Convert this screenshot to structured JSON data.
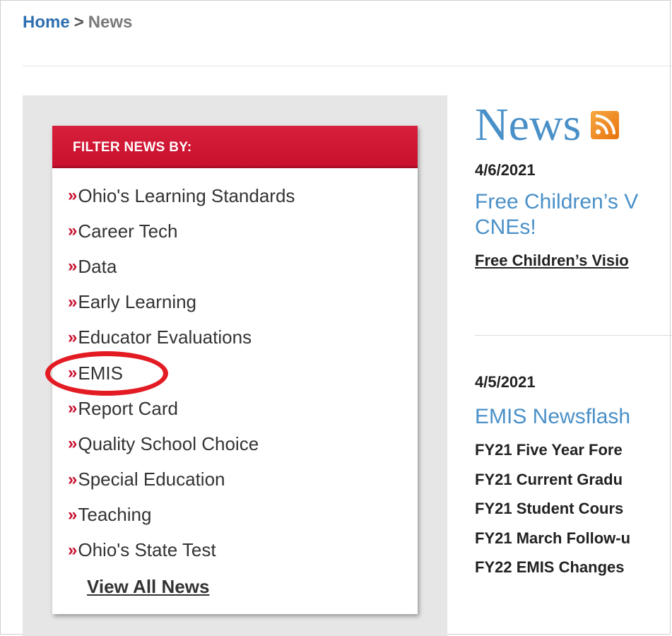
{
  "breadcrumb": {
    "home": "Home",
    "separator": ">",
    "current": "News"
  },
  "filter": {
    "header": "FILTER NEWS BY:",
    "chevron": "»",
    "items": [
      "Ohio's Learning Standards",
      "Career Tech",
      "Data",
      "Early Learning",
      "Educator Evaluations",
      "EMIS",
      "Report Card",
      "Quality School Choice",
      "Special Education",
      "Teaching",
      "Ohio's State Test"
    ],
    "view_all": "View All News",
    "highlighted_item": "EMIS"
  },
  "news": {
    "title": "News",
    "rss_icon": "rss-icon",
    "articles": [
      {
        "date": "4/6/2021",
        "headline_line1": "Free Children’s V",
        "headline_line2": "CNEs!",
        "link": "Free Children’s Visio"
      },
      {
        "date": "4/5/2021",
        "headline_line1": "EMIS Newsflash",
        "lines": [
          "FY21 Five Year Fore",
          "FY21 Current Gradu",
          "FY21 Student Cours",
          "FY21 March Follow-u",
          "FY22 EMIS Changes"
        ]
      }
    ]
  },
  "colors": {
    "accent_red": "#c8102e",
    "link_blue": "#4a90c8",
    "highlight_ring": "#e31b23"
  }
}
